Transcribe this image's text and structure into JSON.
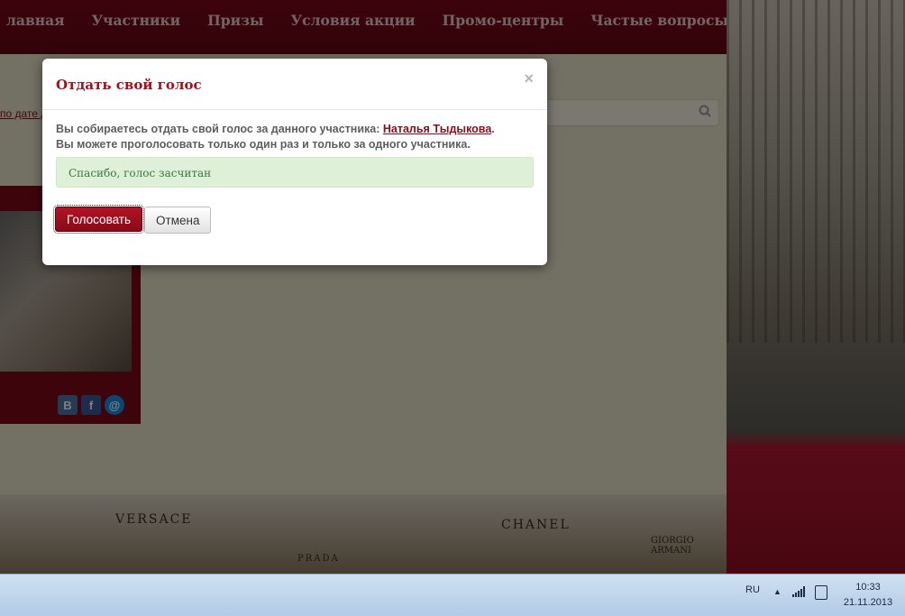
{
  "nav": {
    "items": [
      "Главная",
      "Участники",
      "Призы",
      "Условия акции",
      "Промо-центры",
      "Частые вопросы"
    ],
    "first_visible": "лавная"
  },
  "sort_link": "по дате д",
  "strip_labels": [
    "VERSACE",
    "CHANEL",
    "GIORGIO ARMANI",
    "PRADA"
  ],
  "social_icons": [
    "vk-icon",
    "facebook-icon",
    "mail-icon"
  ],
  "modal": {
    "title": "Отдать свой голос",
    "close_symbol": "×",
    "message_prefix": "Вы собираетесь отдать свой голос за данного участника: ",
    "participant_name": "Наталья Тыдыкова",
    "message_suffix": ".",
    "message_line2": "Вы можете проголосовать только один раз и только за одного участника.",
    "success_text": "Спасибо, голос засчитан",
    "vote_button": "Голосовать",
    "cancel_button": "Отмена"
  },
  "taskbar": {
    "language": "RU",
    "time": "10:33",
    "date": "21.11.2013"
  },
  "colors": {
    "brand_red": "#8a0d1c",
    "success_bg": "#dff0d8",
    "success_text": "#3c763d"
  }
}
